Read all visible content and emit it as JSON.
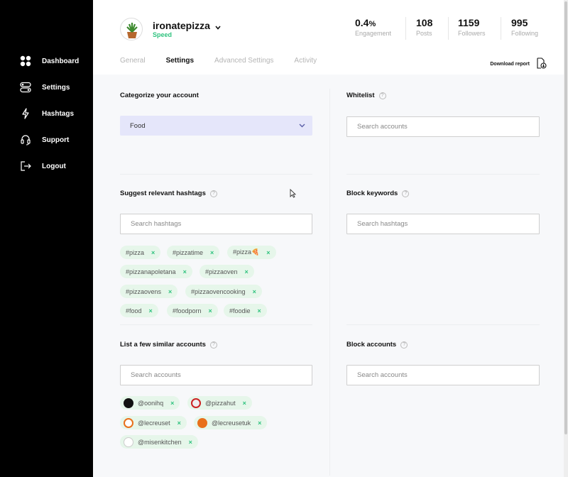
{
  "sidebar": {
    "items": [
      {
        "label": "Dashboard",
        "icon": "grid-icon"
      },
      {
        "label": "Settings",
        "icon": "toggles-icon"
      },
      {
        "label": "Hashtags",
        "icon": "bolt-icon"
      },
      {
        "label": "Support",
        "icon": "headset-icon"
      },
      {
        "label": "Logout",
        "icon": "logout-icon"
      }
    ]
  },
  "account": {
    "name": "ironatepizza",
    "plan": "Speed"
  },
  "stats": [
    {
      "value": "0.4",
      "suffix": "%",
      "label": "Engagement"
    },
    {
      "value": "108",
      "suffix": "",
      "label": "Posts"
    },
    {
      "value": "1159",
      "suffix": "",
      "label": "Followers"
    },
    {
      "value": "995",
      "suffix": "",
      "label": "Following"
    }
  ],
  "tabs": [
    "General",
    "Settings",
    "Advanced Settings",
    "Activity"
  ],
  "active_tab": "Settings",
  "download_label": "Download report",
  "categorize": {
    "title": "Categorize your account",
    "selected": "Food"
  },
  "whitelist": {
    "title": "Whitelist",
    "placeholder": "Search accounts"
  },
  "hashtags": {
    "title": "Suggest relevant hashtags",
    "placeholder": "Search hashtags",
    "chips": [
      "#pizza",
      "#pizzatime",
      "#pizza🍕",
      "#pizzanapoletana",
      "#pizzaoven",
      "#pizzaovens",
      "#pizzaovencooking",
      "#food",
      "#foodporn",
      "#foodie"
    ]
  },
  "block_keywords": {
    "title": "Block keywords",
    "placeholder": "Search hashtags"
  },
  "similar": {
    "title": "List a few similar accounts",
    "placeholder": "Search accounts",
    "chips": [
      "@oonihq",
      "@pizzahut",
      "@lecreuset",
      "@lecreusetuk",
      "@misenkitchen"
    ]
  },
  "block_accounts": {
    "title": "Block accounts",
    "placeholder": "Search accounts"
  },
  "colors": {
    "accent_green": "#2ec27e",
    "chip_bg": "#e6f6ea",
    "select_bg": "#e5e6fa",
    "sidebar_bg": "#000000"
  }
}
